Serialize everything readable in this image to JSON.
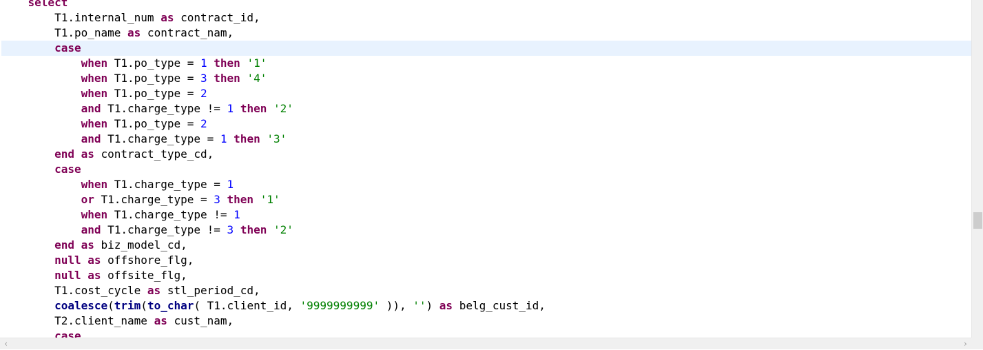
{
  "editor": {
    "current_line": 3,
    "lines": [
      [
        {
          "t": "    ",
          "c": "plain"
        },
        {
          "t": "select",
          "c": "kw"
        }
      ],
      [
        {
          "t": "        T1.internal_num ",
          "c": "plain"
        },
        {
          "t": "as",
          "c": "kw"
        },
        {
          "t": " contract_id,",
          "c": "plain"
        }
      ],
      [
        {
          "t": "        T1.po_name ",
          "c": "plain"
        },
        {
          "t": "as",
          "c": "kw"
        },
        {
          "t": " contract_nam,",
          "c": "plain"
        }
      ],
      [
        {
          "t": "        ",
          "c": "plain"
        },
        {
          "t": "case",
          "c": "kw"
        }
      ],
      [
        {
          "t": "            ",
          "c": "plain"
        },
        {
          "t": "when",
          "c": "kw"
        },
        {
          "t": " T1.po_type = ",
          "c": "plain"
        },
        {
          "t": "1",
          "c": "num"
        },
        {
          "t": " ",
          "c": "plain"
        },
        {
          "t": "then",
          "c": "kw"
        },
        {
          "t": " ",
          "c": "plain"
        },
        {
          "t": "'1'",
          "c": "str"
        }
      ],
      [
        {
          "t": "            ",
          "c": "plain"
        },
        {
          "t": "when",
          "c": "kw"
        },
        {
          "t": " T1.po_type = ",
          "c": "plain"
        },
        {
          "t": "3",
          "c": "num"
        },
        {
          "t": " ",
          "c": "plain"
        },
        {
          "t": "then",
          "c": "kw"
        },
        {
          "t": " ",
          "c": "plain"
        },
        {
          "t": "'4'",
          "c": "str"
        }
      ],
      [
        {
          "t": "            ",
          "c": "plain"
        },
        {
          "t": "when",
          "c": "kw"
        },
        {
          "t": " T1.po_type = ",
          "c": "plain"
        },
        {
          "t": "2",
          "c": "num"
        }
      ],
      [
        {
          "t": "            ",
          "c": "plain"
        },
        {
          "t": "and",
          "c": "kw"
        },
        {
          "t": " T1.charge_type != ",
          "c": "plain"
        },
        {
          "t": "1",
          "c": "num"
        },
        {
          "t": " ",
          "c": "plain"
        },
        {
          "t": "then",
          "c": "kw"
        },
        {
          "t": " ",
          "c": "plain"
        },
        {
          "t": "'2'",
          "c": "str"
        }
      ],
      [
        {
          "t": "            ",
          "c": "plain"
        },
        {
          "t": "when",
          "c": "kw"
        },
        {
          "t": " T1.po_type = ",
          "c": "plain"
        },
        {
          "t": "2",
          "c": "num"
        }
      ],
      [
        {
          "t": "            ",
          "c": "plain"
        },
        {
          "t": "and",
          "c": "kw"
        },
        {
          "t": " T1.charge_type = ",
          "c": "plain"
        },
        {
          "t": "1",
          "c": "num"
        },
        {
          "t": " ",
          "c": "plain"
        },
        {
          "t": "then",
          "c": "kw"
        },
        {
          "t": " ",
          "c": "plain"
        },
        {
          "t": "'3'",
          "c": "str"
        }
      ],
      [
        {
          "t": "        ",
          "c": "plain"
        },
        {
          "t": "end",
          "c": "kw"
        },
        {
          "t": " ",
          "c": "plain"
        },
        {
          "t": "as",
          "c": "kw"
        },
        {
          "t": " contract_type_cd,",
          "c": "plain"
        }
      ],
      [
        {
          "t": "        ",
          "c": "plain"
        },
        {
          "t": "case",
          "c": "kw"
        }
      ],
      [
        {
          "t": "            ",
          "c": "plain"
        },
        {
          "t": "when",
          "c": "kw"
        },
        {
          "t": " T1.charge_type = ",
          "c": "plain"
        },
        {
          "t": "1",
          "c": "num"
        }
      ],
      [
        {
          "t": "            ",
          "c": "plain"
        },
        {
          "t": "or",
          "c": "kw"
        },
        {
          "t": " T1.charge_type = ",
          "c": "plain"
        },
        {
          "t": "3",
          "c": "num"
        },
        {
          "t": " ",
          "c": "plain"
        },
        {
          "t": "then",
          "c": "kw"
        },
        {
          "t": " ",
          "c": "plain"
        },
        {
          "t": "'1'",
          "c": "str"
        }
      ],
      [
        {
          "t": "            ",
          "c": "plain"
        },
        {
          "t": "when",
          "c": "kw"
        },
        {
          "t": " T1.charge_type != ",
          "c": "plain"
        },
        {
          "t": "1",
          "c": "num"
        }
      ],
      [
        {
          "t": "            ",
          "c": "plain"
        },
        {
          "t": "and",
          "c": "kw"
        },
        {
          "t": " T1.charge_type != ",
          "c": "plain"
        },
        {
          "t": "3",
          "c": "num"
        },
        {
          "t": " ",
          "c": "plain"
        },
        {
          "t": "then",
          "c": "kw"
        },
        {
          "t": " ",
          "c": "plain"
        },
        {
          "t": "'2'",
          "c": "str"
        }
      ],
      [
        {
          "t": "        ",
          "c": "plain"
        },
        {
          "t": "end",
          "c": "kw"
        },
        {
          "t": " ",
          "c": "plain"
        },
        {
          "t": "as",
          "c": "kw"
        },
        {
          "t": " biz_model_cd,",
          "c": "plain"
        }
      ],
      [
        {
          "t": "        ",
          "c": "plain"
        },
        {
          "t": "null",
          "c": "kw"
        },
        {
          "t": " ",
          "c": "plain"
        },
        {
          "t": "as",
          "c": "kw"
        },
        {
          "t": " offshore_flg,",
          "c": "plain"
        }
      ],
      [
        {
          "t": "        ",
          "c": "plain"
        },
        {
          "t": "null",
          "c": "kw"
        },
        {
          "t": " ",
          "c": "plain"
        },
        {
          "t": "as",
          "c": "kw"
        },
        {
          "t": " offsite_flg,",
          "c": "plain"
        }
      ],
      [
        {
          "t": "        T1.cost_cycle ",
          "c": "plain"
        },
        {
          "t": "as",
          "c": "kw"
        },
        {
          "t": " stl_period_cd,",
          "c": "plain"
        }
      ],
      [
        {
          "t": "        ",
          "c": "plain"
        },
        {
          "t": "coalesce",
          "c": "fn"
        },
        {
          "t": "(",
          "c": "plain"
        },
        {
          "t": "trim",
          "c": "fn"
        },
        {
          "t": "(",
          "c": "plain"
        },
        {
          "t": "to_char",
          "c": "fn"
        },
        {
          "t": "( T1.client_id, ",
          "c": "plain"
        },
        {
          "t": "'9999999999'",
          "c": "str"
        },
        {
          "t": " )), ",
          "c": "plain"
        },
        {
          "t": "''",
          "c": "str"
        },
        {
          "t": ") ",
          "c": "plain"
        },
        {
          "t": "as",
          "c": "kw"
        },
        {
          "t": " belg_cust_id,",
          "c": "plain"
        }
      ],
      [
        {
          "t": "        T2.client_name ",
          "c": "plain"
        },
        {
          "t": "as",
          "c": "kw"
        },
        {
          "t": " cust_nam,",
          "c": "plain"
        }
      ],
      [
        {
          "t": "        ",
          "c": "plain"
        },
        {
          "t": "case",
          "c": "kw"
        }
      ]
    ]
  },
  "scrollbars": {
    "vertical_position": 0.66,
    "left_arrow": "‹",
    "right_arrow": "›"
  }
}
